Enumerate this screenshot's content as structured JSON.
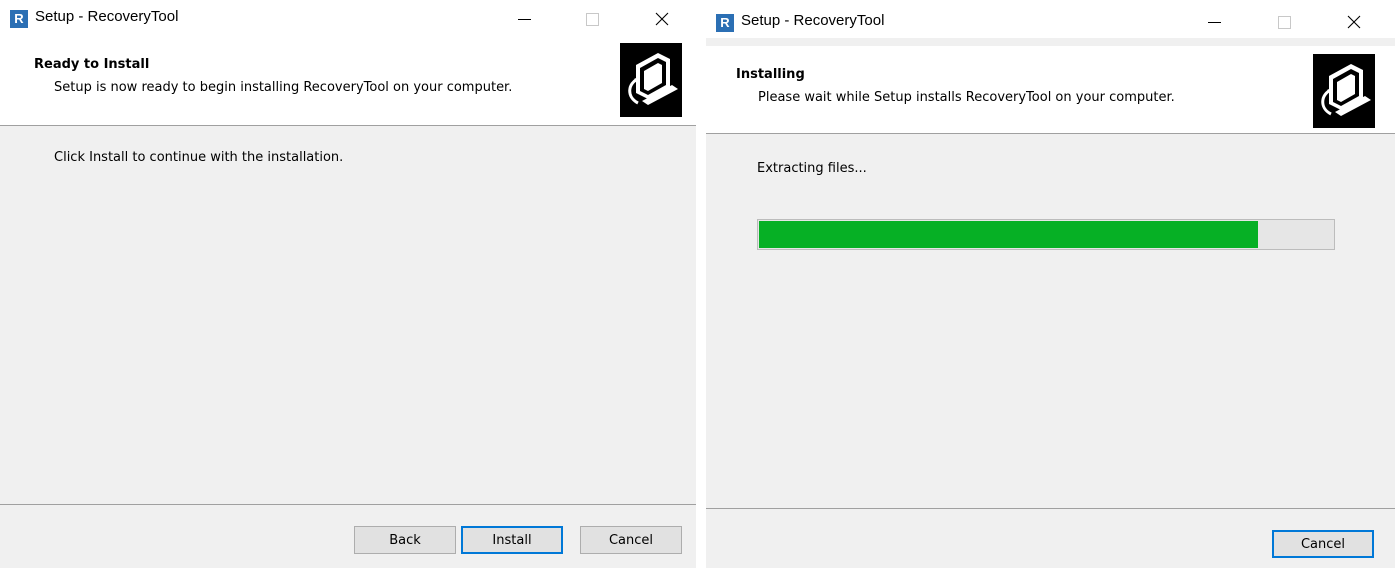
{
  "windows": [
    {
      "title": "Setup - RecoveryTool",
      "app_icon_letter": "R",
      "header_title": "Ready to Install",
      "header_subtitle": "Setup is now ready to begin installing RecoveryTool on your computer.",
      "body_text": "Click Install to continue with the installation.",
      "buttons": {
        "back": "Back",
        "install": "Install",
        "cancel": "Cancel"
      }
    },
    {
      "title": "Setup - RecoveryTool",
      "app_icon_letter": "R",
      "header_title": "Installing",
      "header_subtitle": "Please wait while Setup installs RecoveryTool on your computer.",
      "status_text": "Extracting files...",
      "progress_percent": 87,
      "buttons": {
        "cancel": "Cancel"
      }
    }
  ],
  "colors": {
    "progress_fill": "#06b025",
    "default_button_border": "#0078d7",
    "app_icon": "#2b6fb4"
  },
  "icons": [
    "app-icon",
    "minimize-icon",
    "maximize-icon",
    "close-icon",
    "setup-logo-icon"
  ]
}
